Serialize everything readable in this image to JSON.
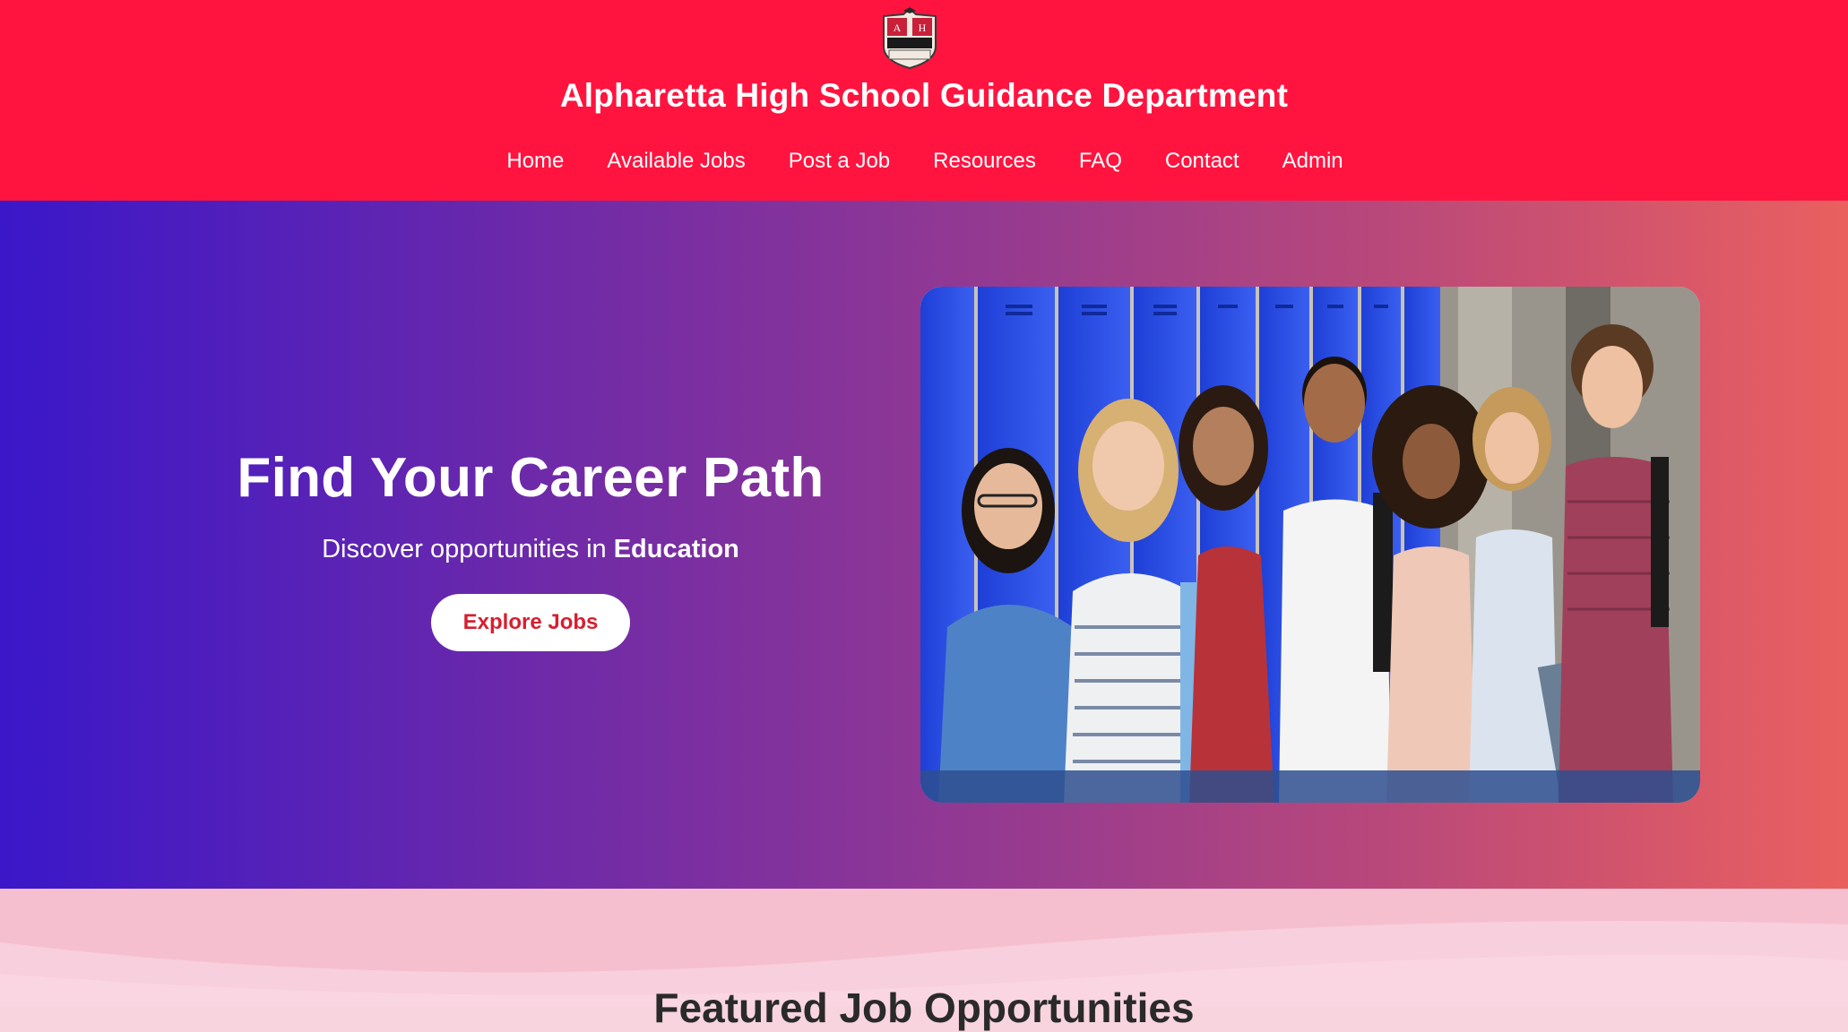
{
  "header": {
    "logo_icon": "school-crest-icon",
    "title": "Alpharetta High School Guidance Department",
    "nav": [
      {
        "label": "Home"
      },
      {
        "label": "Available Jobs"
      },
      {
        "label": "Post a Job"
      },
      {
        "label": "Resources"
      },
      {
        "label": "FAQ"
      },
      {
        "label": "Contact"
      },
      {
        "label": "Admin"
      }
    ]
  },
  "hero": {
    "title": "Find Your Career Path",
    "subtitle_prefix": "Discover opportunities in",
    "subtitle_emphasis": "Education",
    "cta_label": "Explore Jobs"
  },
  "featured": {
    "title": "Featured Job Opportunities"
  },
  "colors": {
    "header_bg": "#ff143f",
    "gradient_start": "#3a17c9",
    "gradient_end": "#ea605f",
    "cta_text": "#d61f2f"
  }
}
